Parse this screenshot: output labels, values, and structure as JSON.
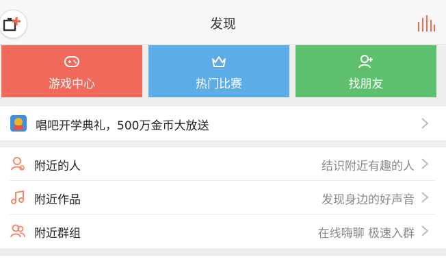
{
  "header": {
    "title": "发现",
    "add_icon": "add-square-icon",
    "chart_icon": "bar-chart-icon"
  },
  "tiles": [
    {
      "label": "游戏中心",
      "icon": "gamepad-icon",
      "color": "#f0695a"
    },
    {
      "label": "热门比赛",
      "icon": "crown-icon",
      "color": "#5cace8"
    },
    {
      "label": "找朋友",
      "icon": "add-friend-icon",
      "color": "#5ec06f"
    }
  ],
  "banner": {
    "text": "唱吧开学典礼，500万金币大放送",
    "icon": "promo-icon"
  },
  "nearby": [
    {
      "label": "附近的人",
      "desc": "结识附近有趣的人",
      "icon": "person-icon"
    },
    {
      "label": "附近作品",
      "desc": "发现身边的好声音",
      "icon": "music-note-icon"
    },
    {
      "label": "附近群组",
      "desc": "在线嗨聊 极速入群",
      "icon": "group-icon"
    }
  ],
  "colors": {
    "accent": "#f36a4a",
    "list_icon": "#f3886a"
  }
}
